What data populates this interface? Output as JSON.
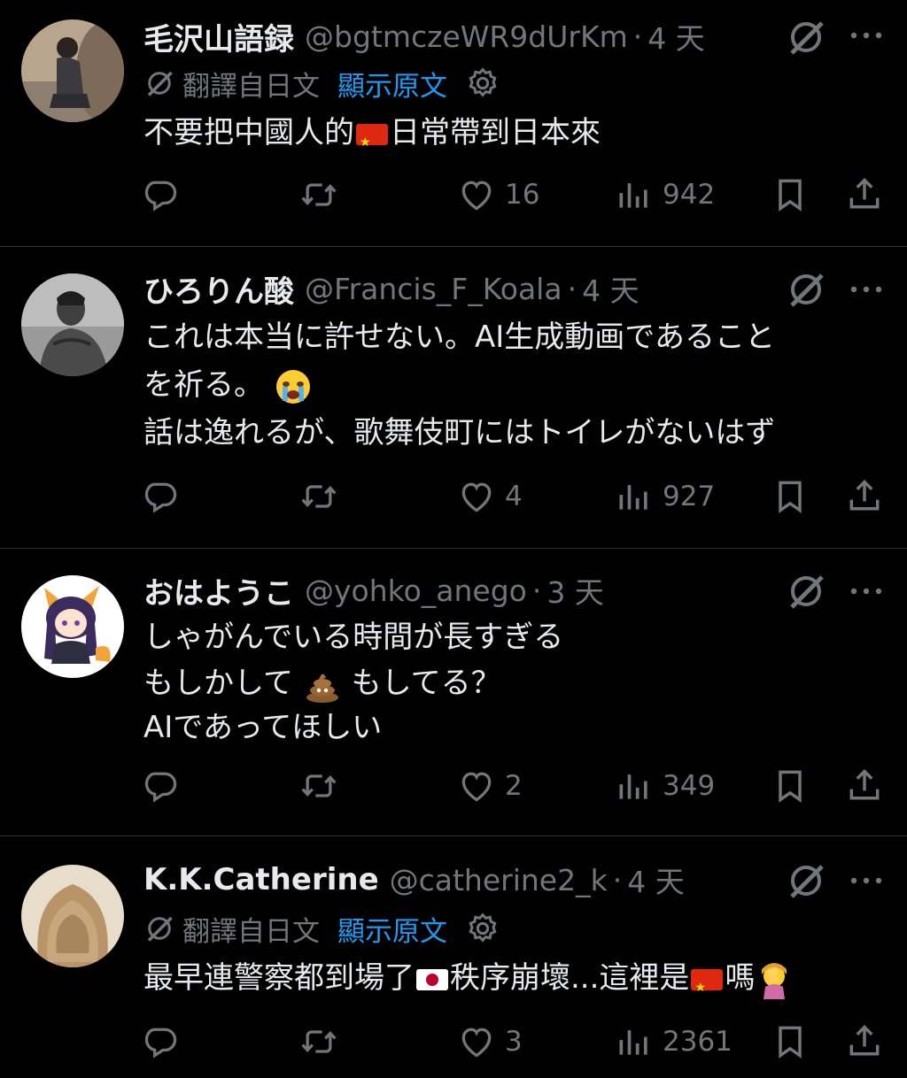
{
  "colors": {
    "background": "#000000",
    "text": "#e7e9ea",
    "muted": "#71767b",
    "link": "#1d9bf0",
    "divider": "#2f3336"
  },
  "translate_label": "翻譯自日文",
  "show_original": "顯示原文",
  "tweets": [
    {
      "name": "毛沢山語録",
      "handle": "@bgtmczeWR9dUrKm",
      "sep": "·",
      "time": "4 天",
      "translated": true,
      "body": {
        "part1": "不要把中國人的",
        "part2": "日常帶到日本來"
      },
      "counts": {
        "likes": "16",
        "views": "942"
      }
    },
    {
      "name": "ひろりん酸",
      "handle": "@Francis_F_Koala",
      "sep": "·",
      "time": "4 天",
      "translated": false,
      "body": {
        "line1": "これは本当に許せない。AI生成動画であること",
        "line2": "を祈る。",
        "line3": "話は逸れるが、歌舞伎町にはトイレがないはず"
      },
      "counts": {
        "likes": "4",
        "views": "927"
      }
    },
    {
      "name": "おはようこ",
      "handle": "@yohko_anego",
      "sep": "·",
      "time": "3 天",
      "translated": false,
      "body": {
        "line1": "しゃがんでいる時間が長すぎる",
        "line2a": "もしかして",
        "line2b": "もしてる？",
        "line3": "AIであってほしい"
      },
      "counts": {
        "likes": "2",
        "views": "349"
      }
    },
    {
      "name": "K.K.Catherine",
      "handle": "@catherine2_k",
      "sep": "·",
      "time": "4 天",
      "translated": true,
      "body": {
        "part1": "最早連警察都到場了",
        "part2": "秩序崩壞...這裡是",
        "part3": "嗎"
      },
      "counts": {
        "likes": "3",
        "views": "2361"
      }
    }
  ],
  "icons": {
    "reply": "reply-icon",
    "retweet": "retweet-icon",
    "like": "heart-icon",
    "views": "views-icon",
    "bookmark": "bookmark-icon",
    "share": "share-icon",
    "grok": "grok-icon",
    "more": "more-icon",
    "gear": "gear-icon",
    "translate": "translate-icon"
  }
}
